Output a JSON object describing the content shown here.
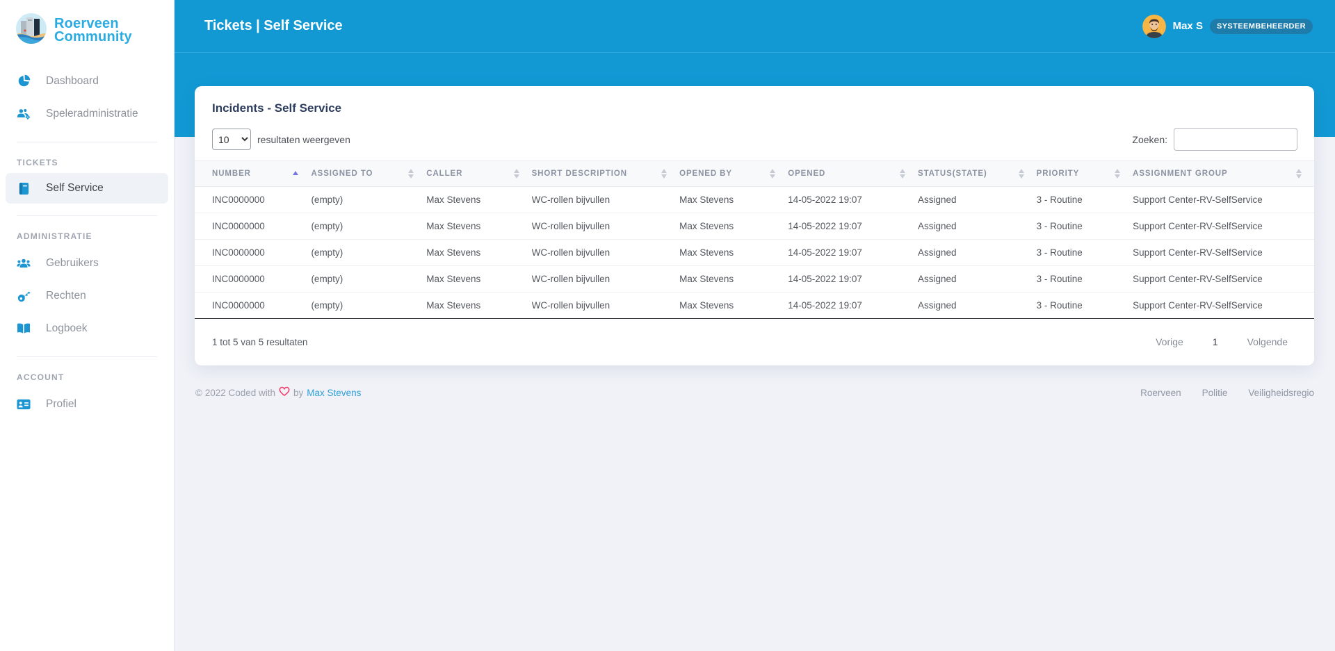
{
  "brand": {
    "name_line1": "Roerveen",
    "name_line2": "Community"
  },
  "header": {
    "title": "Tickets | Self Service",
    "user_name": "Max S",
    "user_badge": "SYSTEEMBEHEERDER"
  },
  "sidebar": {
    "sections": [
      {
        "items": [
          {
            "label": "Dashboard",
            "icon": "pie-chart-icon"
          },
          {
            "label": "Speleradministratie",
            "icon": "users-gear-icon"
          }
        ]
      },
      {
        "heading": "TICKETS",
        "items": [
          {
            "label": "Self Service",
            "icon": "journal-icon",
            "active": true
          }
        ]
      },
      {
        "heading": "ADMINISTRATIE",
        "items": [
          {
            "label": "Gebruikers",
            "icon": "users-icon"
          },
          {
            "label": "Rechten",
            "icon": "key-icon"
          },
          {
            "label": "Logboek",
            "icon": "open-book-icon"
          }
        ]
      },
      {
        "heading": "ACCOUNT",
        "items": [
          {
            "label": "Profiel",
            "icon": "id-card-icon"
          }
        ]
      }
    ]
  },
  "card": {
    "title": "Incidents - Self Service"
  },
  "toolbar": {
    "page_length": "10",
    "length_suffix": "resultaten weergeven",
    "search_label": "Zoeken:",
    "search_value": ""
  },
  "table": {
    "columns": [
      {
        "label": "NUMBER",
        "sort": "asc"
      },
      {
        "label": "ASSIGNED TO",
        "sort": "both"
      },
      {
        "label": "CALLER",
        "sort": "both"
      },
      {
        "label": "SHORT DESCRIPTION",
        "sort": "both"
      },
      {
        "label": "OPENED BY",
        "sort": "both"
      },
      {
        "label": "OPENED",
        "sort": "both"
      },
      {
        "label": "STATUS(STATE)",
        "sort": "both"
      },
      {
        "label": "PRIORITY",
        "sort": "both"
      },
      {
        "label": "ASSIGNMENT GROUP",
        "sort": "both"
      }
    ],
    "rows": [
      [
        "INC0000000",
        "(empty)",
        "Max Stevens",
        "WC-rollen bijvullen",
        "Max Stevens",
        "14-05-2022 19:07",
        "Assigned",
        "3 - Routine",
        "Support Center-RV-SelfService"
      ],
      [
        "INC0000000",
        "(empty)",
        "Max Stevens",
        "WC-rollen bijvullen",
        "Max Stevens",
        "14-05-2022 19:07",
        "Assigned",
        "3 - Routine",
        "Support Center-RV-SelfService"
      ],
      [
        "INC0000000",
        "(empty)",
        "Max Stevens",
        "WC-rollen bijvullen",
        "Max Stevens",
        "14-05-2022 19:07",
        "Assigned",
        "3 - Routine",
        "Support Center-RV-SelfService"
      ],
      [
        "INC0000000",
        "(empty)",
        "Max Stevens",
        "WC-rollen bijvullen",
        "Max Stevens",
        "14-05-2022 19:07",
        "Assigned",
        "3 - Routine",
        "Support Center-RV-SelfService"
      ],
      [
        "INC0000000",
        "(empty)",
        "Max Stevens",
        "WC-rollen bijvullen",
        "Max Stevens",
        "14-05-2022 19:07",
        "Assigned",
        "3 - Routine",
        "Support Center-RV-SelfService"
      ]
    ]
  },
  "summary": {
    "info": "1 tot 5 van 5 resultaten"
  },
  "pagination": {
    "previous": "Vorige",
    "current": "1",
    "next": "Volgende"
  },
  "footer": {
    "copyright_prefix": "© 2022 Coded with",
    "copyright_middle": "by",
    "author": "Max Stevens",
    "links": [
      "Roerveen",
      "Politie",
      "Veiligheidsregio"
    ]
  },
  "colors": {
    "accent": "#1299d4",
    "badge": "#1e7cab",
    "icon-blue": "#1b96d2",
    "link-blue": "#2f9fd9",
    "sort-active": "#7378de",
    "heart": "#ef436f"
  }
}
